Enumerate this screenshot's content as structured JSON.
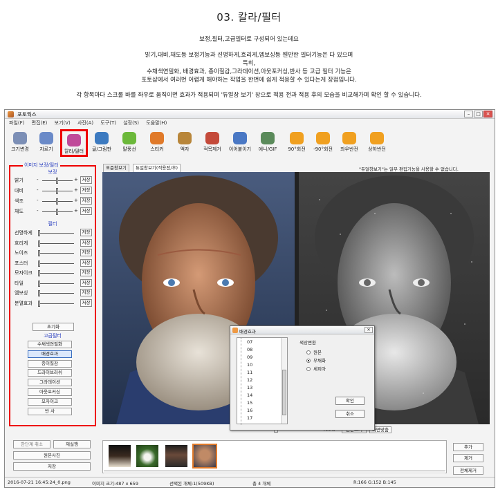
{
  "page": {
    "title": "03. 칼라/필터",
    "lines": [
      "보정,필터,고급필터로 구성되어 있는데요",
      "밝기,대비,채도등 보정기능과 선명하게,흐리게,엠보싱등 웬만한 필터기능은 다 있으며",
      "특히,",
      "수채색연필화, 배경효과, 종이질감,그라데이션,아웃포커싱,반사 등 고급 필터 기능은",
      "포토샵에서 여러번 어렵게 해야하는 작업을 한번에 쉽게 적용할 수 있다는게 장점입니다.",
      "각 항목마다 스크롤 바를 좌우로 움직이면  효과가 적용되며 '듀얼창 보기' 창으로 적용 전과 적용 후의 모습을 비교해가며 확인 할 수 있습니다."
    ]
  },
  "window": {
    "title": "포토웍스",
    "controls": {
      "min": "–",
      "max": "□",
      "close": "✕"
    },
    "menu": [
      "파일(F)",
      "편집(E)",
      "보기(V)",
      "사진(A)",
      "도구(T)",
      "설정(S)",
      "도움말(H)"
    ]
  },
  "toolbar": [
    {
      "label": "크기변경",
      "color": "#7c8fb6"
    },
    {
      "label": "자르기",
      "color": "#6a8ac8"
    },
    {
      "label": "칼라/필터",
      "color": "#c04a9a"
    },
    {
      "label": "글/그림판",
      "color": "#3c7ac0"
    },
    {
      "label": "말풍선",
      "color": "#6bb83a"
    },
    {
      "label": "스티커",
      "color": "#e07a2a"
    },
    {
      "label": "액자",
      "color": "#b8863a"
    },
    {
      "label": "적목제거",
      "color": "#c44a3a"
    },
    {
      "label": "이어붙이기",
      "color": "#4a78c4"
    },
    {
      "label": "애니/GIF",
      "color": "#5a8a5a"
    },
    {
      "label": "90°회전",
      "color": "#f0a020"
    },
    {
      "label": "-90°회전",
      "color": "#f0a020"
    },
    {
      "label": "좌우반전",
      "color": "#f0a020"
    },
    {
      "label": "상하반전",
      "color": "#f0a020"
    }
  ],
  "left_panel": {
    "header": "이미지 보정/필터",
    "correction_title": "보정",
    "correction": [
      {
        "label": "밝기",
        "level": 0.5
      },
      {
        "label": "대비",
        "level": 0.5
      },
      {
        "label": "색조",
        "level": 0.5
      },
      {
        "label": "채도",
        "level": 0.5
      }
    ],
    "filter_title": "필터",
    "filters": [
      {
        "label": "선명하게",
        "level": 0
      },
      {
        "label": "흐리게",
        "level": 0
      },
      {
        "label": "노이즈",
        "level": 0
      },
      {
        "label": "포스터",
        "level": 0
      },
      {
        "label": "모자이크",
        "level": 0
      },
      {
        "label": "타일",
        "level": 0
      },
      {
        "label": "엠보싱",
        "level": 0
      },
      {
        "label": "분열효과",
        "level": 0
      }
    ],
    "save_label": "저장",
    "minus": "-",
    "plus": "+",
    "reset_label": "초기화",
    "advanced_title": "고급필터",
    "advanced": [
      "수채색연필화",
      "배경효과",
      "종이질감",
      "드라이브러쉬",
      "그라데이션",
      "아웃포커싱",
      "모자이크",
      "반        사"
    ]
  },
  "tabs": [
    "표준창보기",
    "듀얼창보기(적용전/후)"
  ],
  "notice": "\"듀얼창보기\"는 일부 편집기능을 사용할 수 없습니다.",
  "zoom": {
    "value": "400%",
    "btn1": "원본크기",
    "btn2": "화면맞춤"
  },
  "dialog": {
    "title": "배경효과",
    "items": [
      "07",
      "08",
      "09",
      "10",
      "11",
      "12",
      "13",
      "14",
      "15",
      "16",
      "17"
    ],
    "group_label": "색상변환",
    "options": [
      "원본",
      "무채화",
      "세피아"
    ],
    "selected_option": "무채화",
    "ok": "확인",
    "cancel": "취소",
    "close": "✕"
  },
  "bottom": {
    "undo": "한단계 취소",
    "redo": "재실행",
    "original": "원본사진",
    "save": "저장",
    "add": "추가",
    "remove": "제거",
    "remove_all": "전체제거"
  },
  "status": {
    "file": "2016-07-21 16:45:24_0.png",
    "size": "이미지 크기:487 x 659",
    "selected": "선택된 개체:1(509KB)",
    "total": "총 4 개체",
    "color": "R:166 G:152 B:145"
  }
}
